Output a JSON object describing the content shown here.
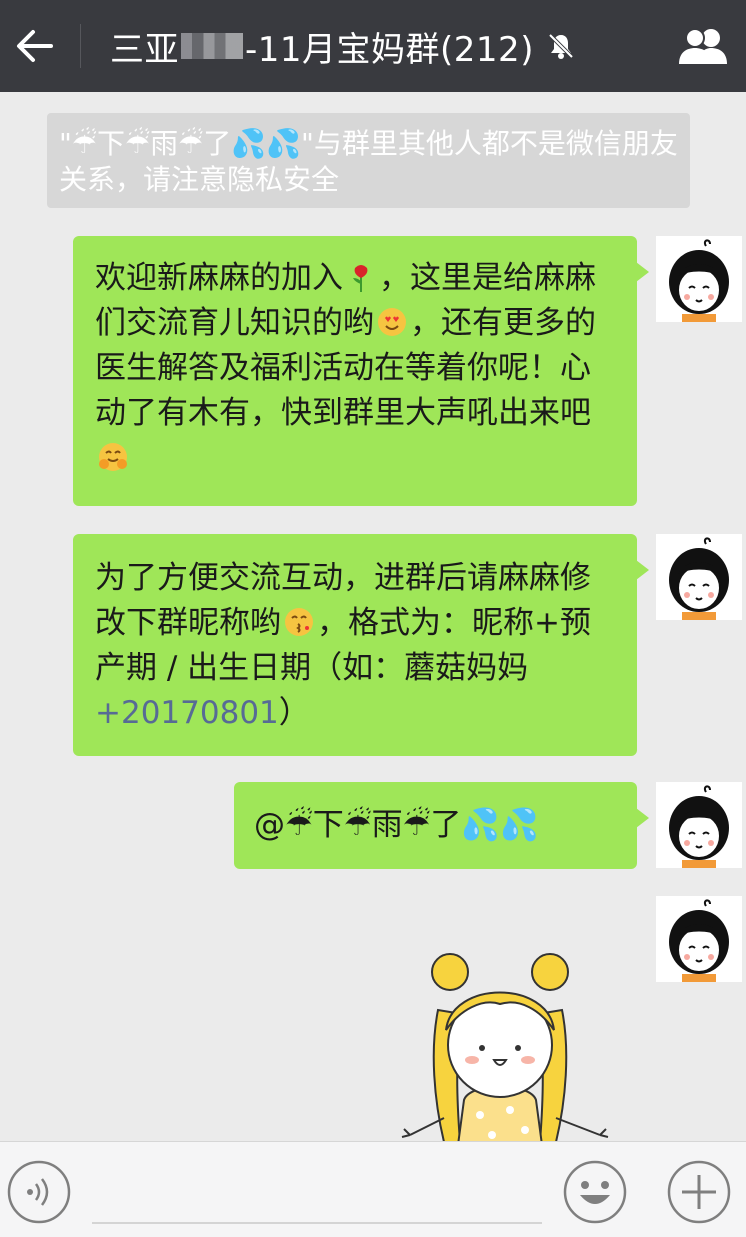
{
  "header": {
    "title_prefix": "三亚",
    "title_suffix": "-11月宝妈群(212)",
    "back_icon": "arrow-left-icon",
    "mute_icon": "bell-off-icon",
    "members_icon": "group-members-icon"
  },
  "system_notice": {
    "sender_name": "☔下☔雨☔了💦💦",
    "text": "与群里其他人都不是微信朋友关系，请注意隐私安全"
  },
  "messages": [
    {
      "part1": "欢迎新麻麻的加入",
      "part2": "，这里是给麻麻们交流育儿知识的哟",
      "part3": "，还有更多的医生解答及福利活动在等着你呢！心动了有木有，快到群里大声吼出来吧",
      "emojis": [
        "rose-icon",
        "heart-eyes-icon",
        "hug-face-icon"
      ]
    },
    {
      "part1": "为了方便交流互动，进群后请麻麻修改下群昵称哟",
      "part2": "，格式为：昵称+预产期 / 出生日期（如：蘑菇妈妈",
      "link": "+20170801",
      "part3": "）",
      "emojis": [
        "kiss-face-icon"
      ]
    },
    {
      "mention": "@☔下☔雨☔了💦💦"
    }
  ],
  "input_bar": {
    "voice_icon": "voice-icon",
    "emoji_icon": "emoji-icon",
    "plus_icon": "plus-icon",
    "placeholder": ""
  },
  "colors": {
    "header_bg": "#393a3f",
    "chat_bg": "#ebebeb",
    "bubble_green": "#9fe658",
    "link_blue": "#576b95"
  }
}
